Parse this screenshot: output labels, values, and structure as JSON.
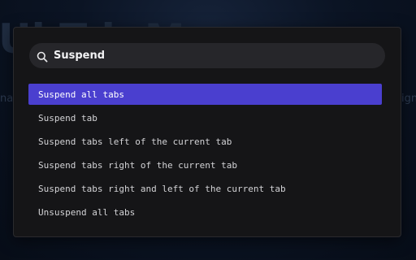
{
  "background": {
    "title_fragment": "Ul    T b M",
    "left_fragment": "nar",
    "right_fragment": "ign"
  },
  "palette": {
    "search": {
      "value": "Suspend",
      "icon": "search-icon"
    },
    "results": [
      {
        "label": "Suspend all tabs",
        "selected": true
      },
      {
        "label": "Suspend tab",
        "selected": false
      },
      {
        "label": "Suspend tabs left of the current tab",
        "selected": false
      },
      {
        "label": "Suspend tabs right of the current tab",
        "selected": false
      },
      {
        "label": "Suspend tabs right and left of the current tab",
        "selected": false
      },
      {
        "label": "Unsuspend all tabs",
        "selected": false
      }
    ],
    "colors": {
      "selected_background": "#4a3fcf",
      "panel_background": "#151517",
      "search_background": "#26262a"
    }
  }
}
